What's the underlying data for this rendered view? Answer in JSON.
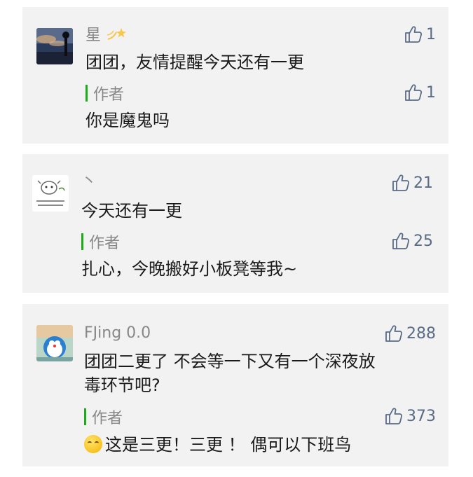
{
  "comments": [
    {
      "nickname": "星",
      "text": "团团，友情提醒今天还有一更",
      "likes": "1",
      "reply_label": "作者",
      "reply_text": "你是魔鬼吗",
      "reply_likes": "1"
    },
    {
      "nickname": "丶",
      "text": "今天还有一更",
      "likes": "21",
      "reply_label": "作者",
      "reply_text": "扎心，今晚搬好小板凳等我~",
      "reply_likes": "25"
    },
    {
      "nickname": "FJing 0.0",
      "text_line1": "团团二更了 不会等一下又有一个深夜放",
      "text_line2": "毒环节吧?",
      "likes": "288",
      "reply_label": "作者",
      "reply_text": "这是三更！三更 ！ 偶可以下班鸟",
      "reply_likes": "373"
    }
  ],
  "colors": {
    "card_bg": "#f2f2f2",
    "author_bar": "#1aad19",
    "like_color": "#5a6b85"
  }
}
